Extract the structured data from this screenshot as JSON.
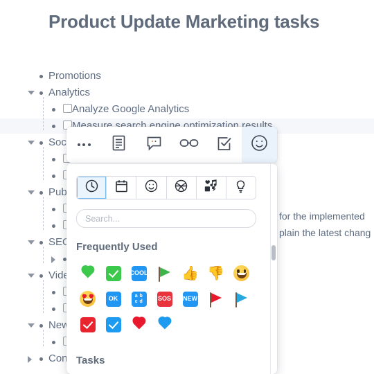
{
  "document": {
    "title": "Product Update Marketing tasks",
    "outline": [
      {
        "indent": 1,
        "toggle": "none",
        "marker": "bullet",
        "label": "Promotions"
      },
      {
        "indent": 1,
        "toggle": "expanded",
        "marker": "bullet",
        "label": "Analytics"
      },
      {
        "indent": 2,
        "toggle": "none",
        "marker": "checkbox",
        "label": "Analyze Google Analytics"
      },
      {
        "indent": 2,
        "toggle": "none",
        "marker": "checkbox",
        "label": "Measure search engine optimization results",
        "highlighted": true
      },
      {
        "indent": 1,
        "toggle": "expanded",
        "marker": "bullet",
        "label": "Social media"
      },
      {
        "indent": 2,
        "toggle": "none",
        "marker": "checkbox",
        "label": ""
      },
      {
        "indent": 2,
        "toggle": "none",
        "marker": "checkbox",
        "label": ""
      },
      {
        "indent": 1,
        "toggle": "expanded",
        "marker": "bullet",
        "label": "Publishing"
      },
      {
        "indent": 2,
        "toggle": "none",
        "marker": "checkbox",
        "label": ""
      },
      {
        "indent": 2,
        "toggle": "none",
        "marker": "checkbox",
        "label": ""
      },
      {
        "indent": 1,
        "toggle": "expanded",
        "marker": "bullet",
        "label": "SEO"
      },
      {
        "indent": 2,
        "toggle": "collapsed",
        "marker": "bullet",
        "label": ""
      },
      {
        "indent": 1,
        "toggle": "expanded",
        "marker": "bullet",
        "label": "Video"
      },
      {
        "indent": 2,
        "toggle": "none",
        "marker": "checkbox",
        "label": ""
      },
      {
        "indent": 2,
        "toggle": "none",
        "marker": "checkbox",
        "label": ""
      },
      {
        "indent": 1,
        "toggle": "expanded",
        "marker": "bullet",
        "label": "Newsletter"
      },
      {
        "indent": 2,
        "toggle": "none",
        "marker": "checkbox",
        "label": ""
      },
      {
        "indent": 1,
        "toggle": "collapsed",
        "marker": "bullet",
        "label": "Content"
      }
    ],
    "overflow_text": [
      "for the implemented",
      "plain the latest chang"
    ]
  },
  "toolbar": {
    "buttons": [
      {
        "name": "more-options",
        "icon": "ellipsis-icon",
        "active": false
      },
      {
        "name": "note",
        "icon": "note-icon",
        "active": false
      },
      {
        "name": "comment",
        "icon": "comment-icon",
        "active": false
      },
      {
        "name": "link",
        "icon": "link-icon",
        "active": false
      },
      {
        "name": "task",
        "icon": "checkbox-icon",
        "active": false
      },
      {
        "name": "emoji",
        "icon": "smiley-icon",
        "active": true
      }
    ]
  },
  "emoji_picker": {
    "category_tabs": [
      {
        "name": "frequently-used",
        "icon": "clock-icon",
        "active": true
      },
      {
        "name": "tasks",
        "icon": "calendar-icon",
        "active": false
      },
      {
        "name": "smileys",
        "icon": "smiley-icon",
        "active": false
      },
      {
        "name": "activities",
        "icon": "basketball-icon",
        "active": false
      },
      {
        "name": "objects",
        "icon": "media-icon",
        "active": false
      },
      {
        "name": "ideas",
        "icon": "lightbulb-icon",
        "active": false
      }
    ],
    "search": {
      "value": "",
      "placeholder": "Search..."
    },
    "sections": [
      {
        "title": "Frequently Used",
        "rows": [
          [
            {
              "name": "green-heart",
              "kind": "heart",
              "color": "#3cc84b"
            },
            {
              "name": "white-check-mark",
              "kind": "checkbox",
              "color": "#3cc84b"
            },
            {
              "name": "cool-button",
              "kind": "badge",
              "color": "#2196f3",
              "text": "COOL"
            },
            {
              "name": "green-flag",
              "kind": "flag",
              "color": "#3cb54a"
            },
            {
              "name": "thumbs-up",
              "kind": "glyph",
              "text": "👍"
            },
            {
              "name": "thumbs-down",
              "kind": "glyph",
              "text": "👎"
            },
            {
              "name": "grinning-face",
              "kind": "face",
              "variant": "grin"
            }
          ],
          [
            {
              "name": "smiling-face-with-hearts",
              "kind": "face",
              "variant": "hearts"
            },
            {
              "name": "ok-button",
              "kind": "badge",
              "color": "#2196f3",
              "text": "OK"
            },
            {
              "name": "input-symbol-latin-letters",
              "kind": "badge",
              "color": "#2196f3",
              "text": "abcd"
            },
            {
              "name": "sos-button",
              "kind": "badge",
              "color": "#e8323c",
              "text": "SOS"
            },
            {
              "name": "new-button",
              "kind": "badge",
              "color": "#2196f3",
              "text": "NEW"
            },
            {
              "name": "triangular-flag-red",
              "kind": "flag",
              "color": "#e8192c"
            },
            {
              "name": "triangular-flag-blue",
              "kind": "flag",
              "color": "#29a8e0"
            }
          ],
          [
            {
              "name": "red-check-box",
              "kind": "checkbox",
              "color": "#e8252f"
            },
            {
              "name": "blue-check-box",
              "kind": "checkbox",
              "color": "#1d9bf0"
            },
            {
              "name": "red-heart",
              "kind": "heart",
              "color": "#e8192c"
            },
            {
              "name": "blue-heart",
              "kind": "heart",
              "color": "#1d9bf0"
            }
          ]
        ]
      },
      {
        "title": "Tasks",
        "rows": []
      }
    ]
  },
  "colors": {
    "text": "#5d6b80",
    "title": "#5f6b7a",
    "accent": "#2196f3",
    "active_tab_bg": "#eaf4fd",
    "active_toolbar_bg": "#eaf3fc",
    "panel_bg": "#ffffff",
    "highlight_row": "#f5f7fa"
  }
}
